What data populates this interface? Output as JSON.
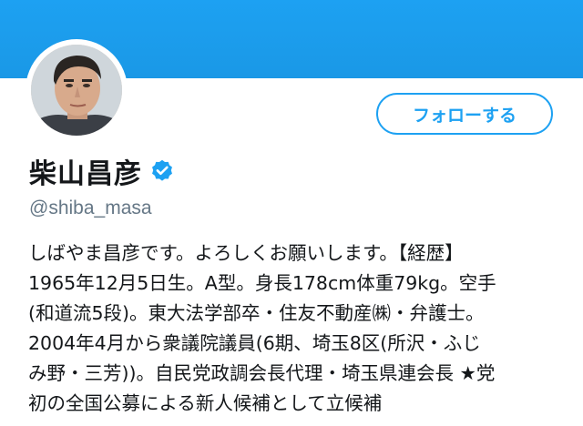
{
  "profile": {
    "display_name": "柴山昌彦",
    "handle": "@shiba_masa",
    "verified": true,
    "follow_label": "フォローする",
    "avatar_icon": "profile-photo",
    "bio_lines": [
      "しばやま昌彦です。よろしくお願いします。【経歴】",
      "1965年12月5日生。A型。身長178cm体重79kg。空手",
      "(和道流5段)。東大法学部卒・住友不動産㈱・弁護士。",
      "2004年4月から衆議院議員(6期、埼玉8区(所沢・ふじ",
      "み野・三芳))。自民党政調会長代理・埼玉県連会長 ★党",
      "初の全国公募による新人候補として立候補"
    ]
  },
  "colors": {
    "banner": "#1da1f2",
    "accent": "#1da1f2",
    "text": "#14171a",
    "muted": "#657786"
  }
}
